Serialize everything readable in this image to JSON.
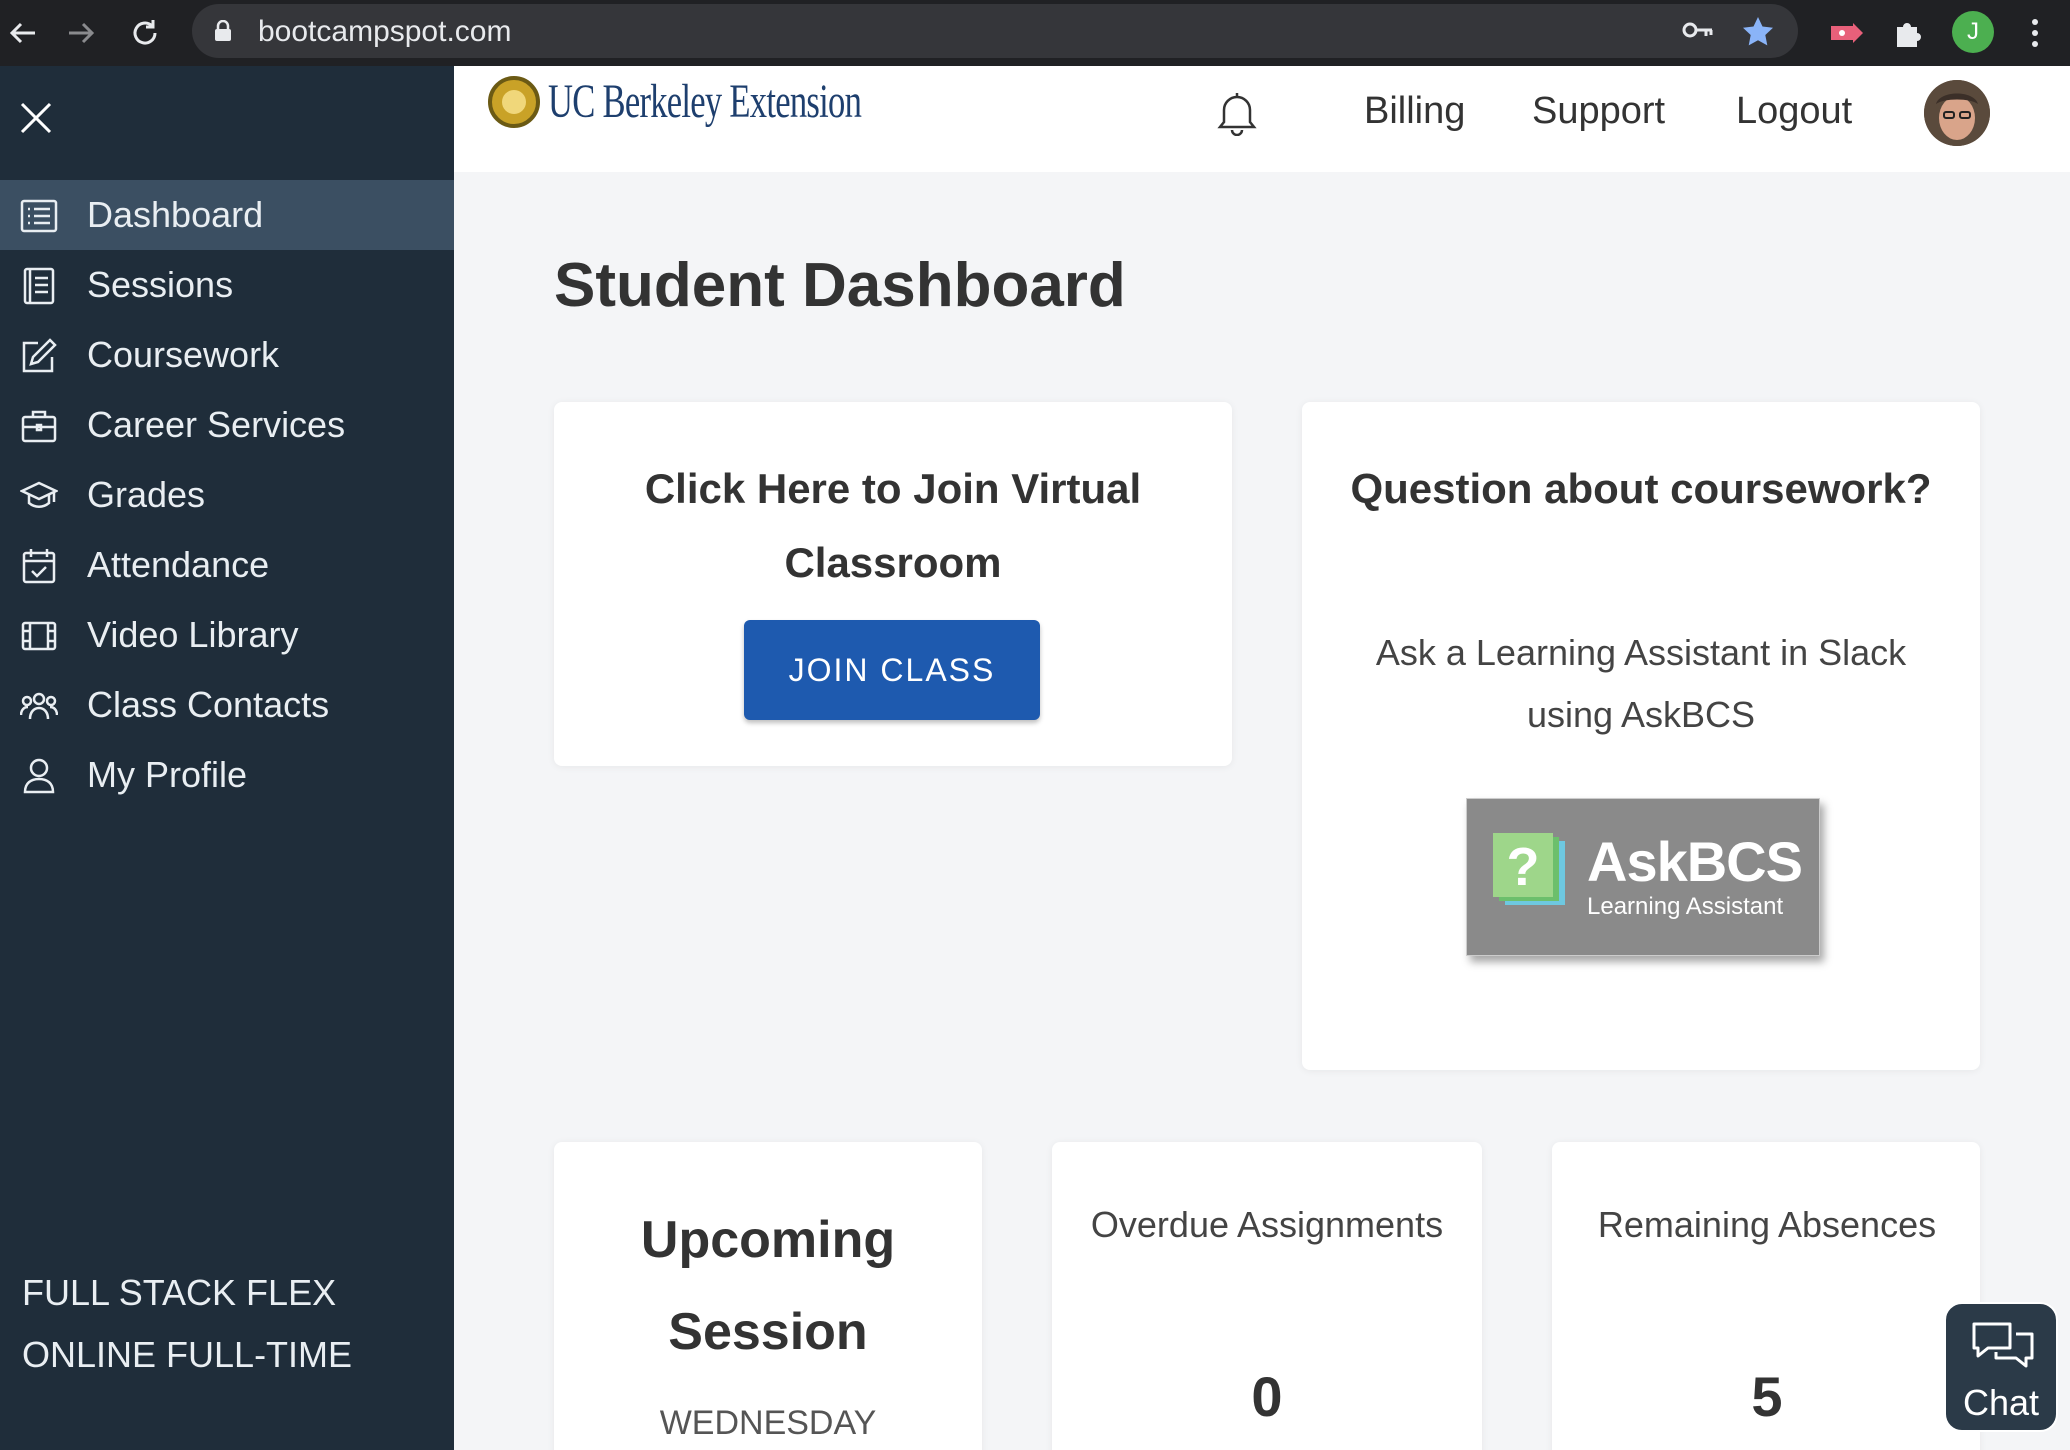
{
  "browser": {
    "url": "bootcampspot.com",
    "profile_initial": "J"
  },
  "sidebar": {
    "items": [
      {
        "label": "Dashboard",
        "icon": "list-icon",
        "active": true
      },
      {
        "label": "Sessions",
        "icon": "notebook-icon"
      },
      {
        "label": "Coursework",
        "icon": "edit-icon"
      },
      {
        "label": "Career Services",
        "icon": "briefcase-icon"
      },
      {
        "label": "Grades",
        "icon": "graduation-cap-icon"
      },
      {
        "label": "Attendance",
        "icon": "calendar-check-icon"
      },
      {
        "label": "Video Library",
        "icon": "film-icon"
      },
      {
        "label": "Class Contacts",
        "icon": "people-icon"
      },
      {
        "label": "My Profile",
        "icon": "user-icon"
      }
    ],
    "program_line1": "FULL STACK FLEX",
    "program_line2": "ONLINE FULL-TIME"
  },
  "header": {
    "logo_text": "UC Berkeley Extension",
    "links": {
      "billing": "Billing",
      "support": "Support",
      "logout": "Logout"
    }
  },
  "main": {
    "title": "Student Dashboard",
    "join_card": {
      "title": "Click Here to Join Virtual Classroom",
      "button": "JOIN CLASS"
    },
    "question_card": {
      "title": "Question about coursework?",
      "text": "Ask a Learning Assistant in Slack using AskBCS",
      "banner_name": "AskBCS",
      "banner_sub": "Learning Assistant"
    },
    "session_card": {
      "title": "Upcoming Session",
      "day": "WEDNESDAY"
    },
    "overdue_card": {
      "label": "Overdue Assignments",
      "value": "0"
    },
    "absences_card": {
      "label": "Remaining Absences",
      "value": "5"
    }
  },
  "chat": {
    "label": "Chat"
  },
  "colors": {
    "sidebar": "#1f2d3a",
    "sidebar_active": "#3b4f62",
    "primary_button": "#1e5aaf",
    "background": "#f4f5f7"
  }
}
